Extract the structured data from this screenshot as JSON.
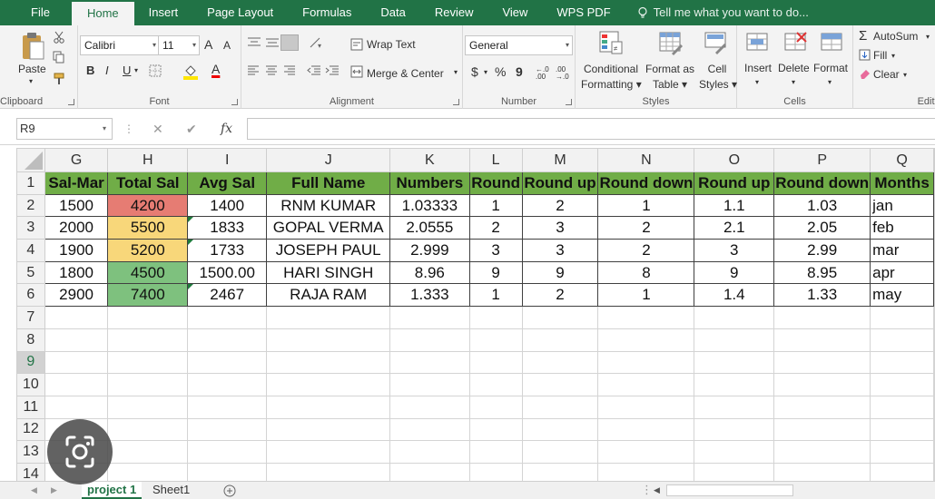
{
  "menu": {
    "tabs": [
      "File",
      "Home",
      "Insert",
      "Page Layout",
      "Formulas",
      "Data",
      "Review",
      "View",
      "WPS PDF"
    ],
    "active": "Home",
    "tell_me": "Tell me what you want to do..."
  },
  "ribbon": {
    "clipboard": {
      "paste": "Paste",
      "label": "Clipboard"
    },
    "font": {
      "name": "Calibri",
      "size": "11",
      "grow": "A",
      "shrink": "A",
      "bold": "B",
      "italic": "I",
      "underline": "U",
      "font_color_glyph": "A",
      "label": "Font"
    },
    "alignment": {
      "wrap_text": "Wrap Text",
      "merge_center": "Merge & Center",
      "label": "Alignment"
    },
    "number": {
      "format": "General",
      "currency": "$",
      "percent": "%",
      "comma": "9",
      "inc_dec": "←.0 .00",
      "dec_dec": ".00 →.0",
      "label": "Number"
    },
    "styles": {
      "conditional_1": "Conditional",
      "conditional_2": "Formatting",
      "format_as_1": "Format as",
      "format_as_2": "Table",
      "cell_styles_1": "Cell",
      "cell_styles_2": "Styles",
      "label": "Styles"
    },
    "cells": {
      "insert": "Insert",
      "delete": "Delete",
      "format": "Format",
      "label": "Cells"
    },
    "editing": {
      "autosum": "AutoSum",
      "fill": "Fill",
      "clear": "Clear",
      "label": "Editi"
    }
  },
  "formula_bar": {
    "name_box": "R9",
    "cancel": "✕",
    "enter": "✔",
    "fx": "fx",
    "value": ""
  },
  "columns": [
    "G",
    "H",
    "I",
    "J",
    "K",
    "L",
    "M",
    "N",
    "O",
    "P",
    "Q"
  ],
  "rows": [
    "1",
    "2",
    "3",
    "4",
    "5",
    "6",
    "7",
    "8",
    "9",
    "10",
    "11",
    "12",
    "13",
    "14"
  ],
  "selected_row": "9",
  "header_row": [
    "Sal-Mar",
    "Total Sal",
    "Avg Sal",
    "Full Name",
    "Numbers",
    "Round",
    "Round up",
    "Round down",
    "Round up",
    "Round down",
    "Months"
  ],
  "data_rows": [
    [
      "1500",
      "4200",
      "1400",
      "RNM  KUMAR",
      "1.03333",
      "1",
      "2",
      "1",
      "1.1",
      "1.03",
      "jan"
    ],
    [
      "2000",
      "5500",
      "1833",
      "GOPAL  VERMA",
      "2.0555",
      "2",
      "3",
      "2",
      "2.1",
      "2.05",
      "feb"
    ],
    [
      "1900",
      "5200",
      "1733",
      "JOSEPH  PAUL",
      "2.999",
      "3",
      "3",
      "2",
      "3",
      "2.99",
      "mar"
    ],
    [
      "1800",
      "4500",
      "1500.00",
      "HARI  SINGH",
      "8.96",
      "9",
      "9",
      "8",
      "9",
      "8.95",
      "apr"
    ],
    [
      "2900",
      "7400",
      "2467",
      "RAJA  RAM",
      "1.333",
      "1",
      "2",
      "1",
      "1.4",
      "1.33",
      "may"
    ]
  ],
  "colors": {
    "header_fill": "#70ad47",
    "high": "#e67c73",
    "mid": "#f8d77a",
    "low": "#7ec17e",
    "brand": "#217346"
  },
  "sheet_tabs": [
    "project 1",
    "Sheet1"
  ],
  "active_sheet": "project 1"
}
